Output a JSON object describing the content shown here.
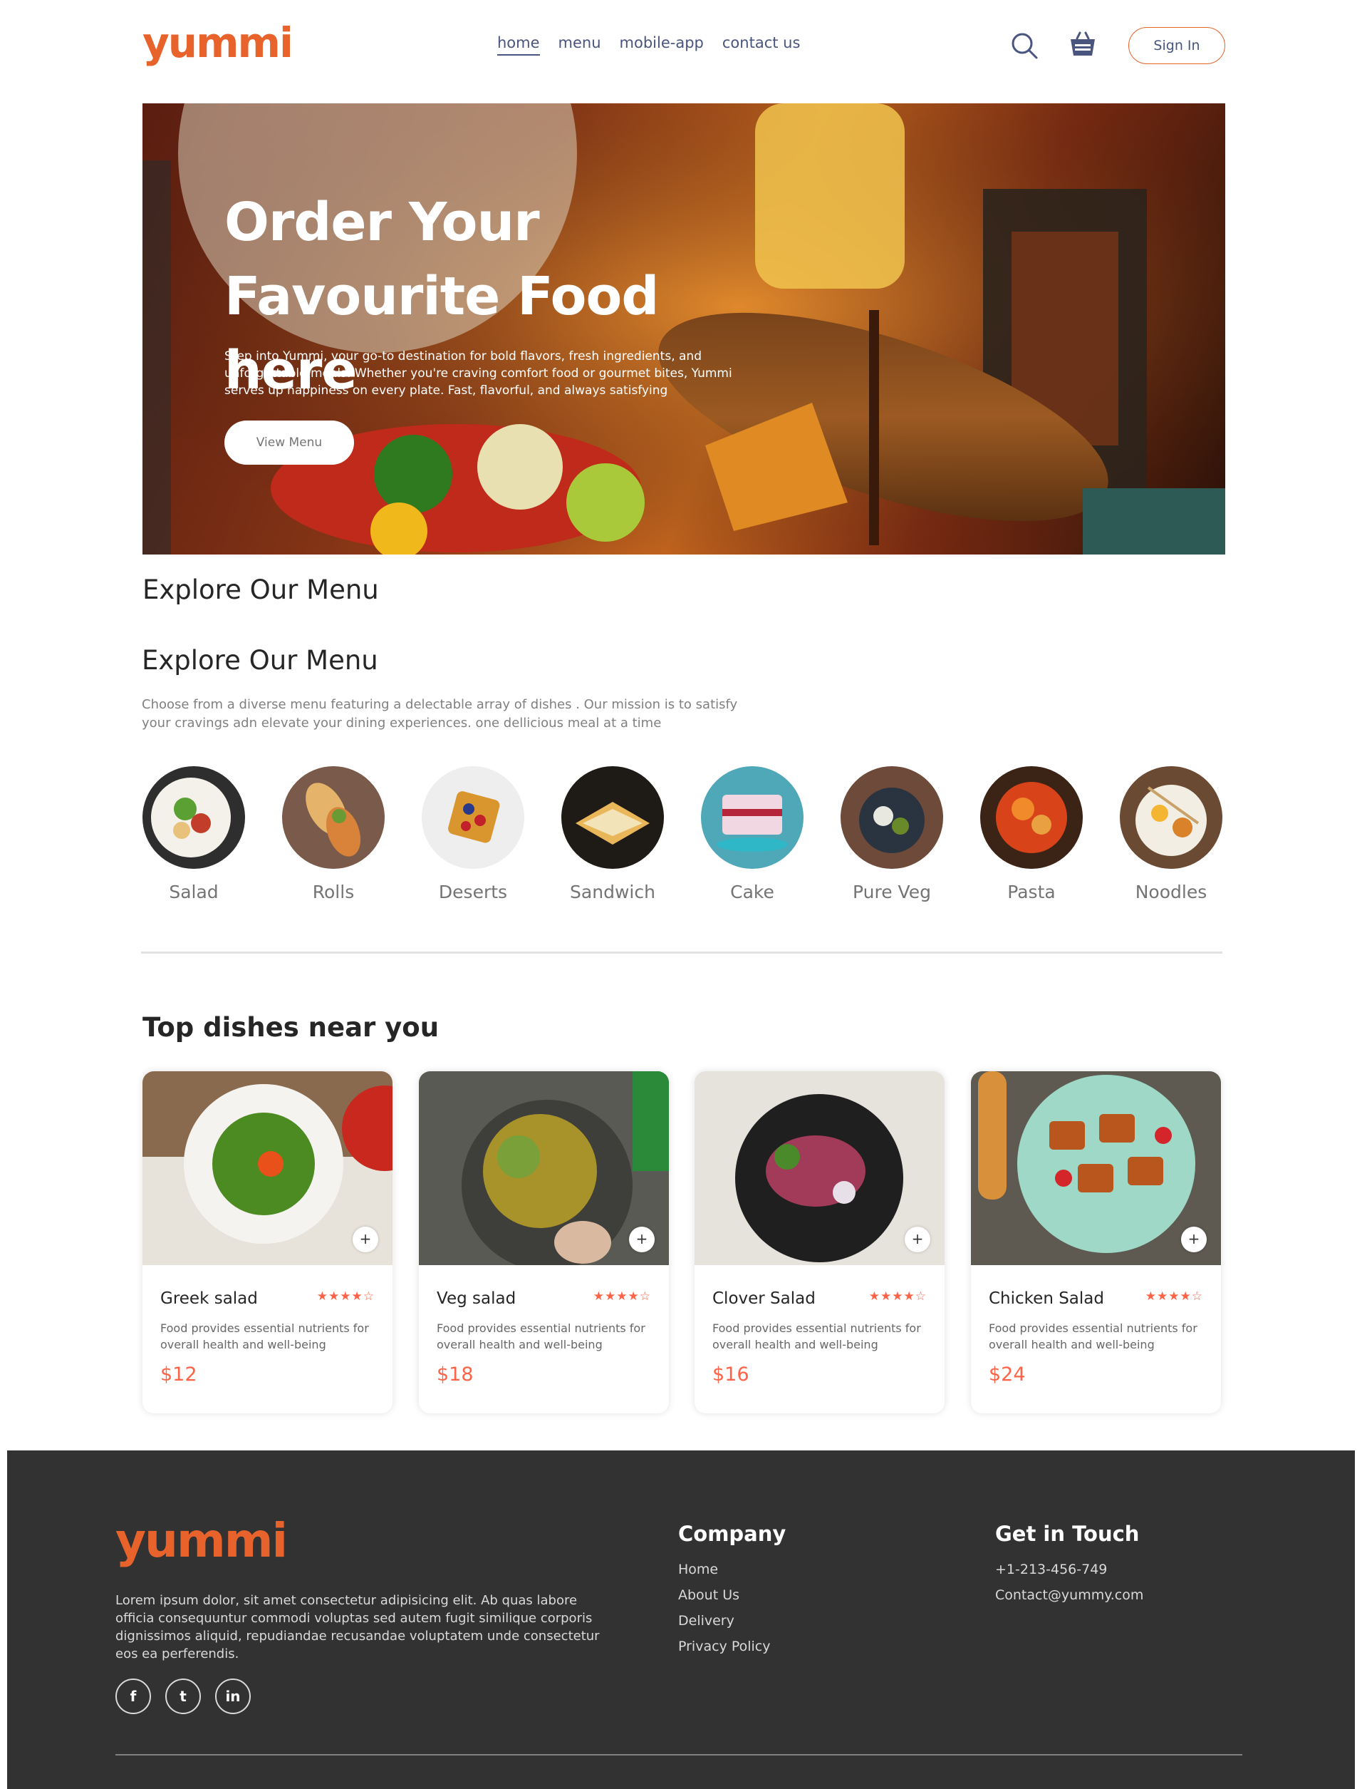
{
  "brand": {
    "name": "yummi",
    "accent": "#e8632c",
    "price_color": "#ff6347"
  },
  "navbar": {
    "links": [
      "home",
      "menu",
      "mobile-app",
      "contact us"
    ],
    "active": "home",
    "search_icon": "search-icon",
    "basket_icon": "basket-icon",
    "signin_label": "Sign In"
  },
  "hero": {
    "title": "Order Your Favourite Food here",
    "text": "Step into Yummi, your go-to destination for bold flavors, fresh ingredients, and unforgettable meals. Whether you're craving comfort food or gourmet bites, Yummi serves up happiness on every plate. Fast, flavorful, and always satisfying",
    "button_label": "View Menu"
  },
  "menu": {
    "heading_1": "Explore Our Menu",
    "heading_2": "Explore Our Menu",
    "description": "Choose from a diverse menu featuring a delectable array of dishes . Our mission is to satisfy your cravings adn elevate your dining experiences. one dellicious meal at a time",
    "items": [
      "Salad",
      "Rolls",
      "Deserts",
      "Sandwich",
      "Cake",
      "Pure Veg",
      "Pasta",
      "Noodles"
    ]
  },
  "dishes": {
    "title": "Top dishes near you",
    "items": [
      {
        "name": "Greek salad",
        "rating": "★★★★☆",
        "description": "Food provides essential nutrients for overall health and well-being",
        "price": "$12"
      },
      {
        "name": "Veg salad",
        "rating": "★★★★☆",
        "description": "Food provides essential nutrients for overall health and well-being",
        "price": "$18"
      },
      {
        "name": "Clover Salad",
        "rating": "★★★★☆",
        "description": "Food provides essential nutrients for overall health and well-being",
        "price": "$16"
      },
      {
        "name": "Chicken Salad",
        "rating": "★★★★☆",
        "description": "Food provides essential nutrients for overall health and well-being",
        "price": "$24"
      }
    ],
    "add_symbol": "+"
  },
  "footer": {
    "logo": "yummi",
    "text": "Lorem ipsum dolor, sit amet consectetur adipisicing elit. Ab quas labore officia consequuntur commodi voluptas sed autem fugit similique corporis dignissimos aliquid, repudiandae recusandae voluptatem unde consectetur eos ea perferendis.",
    "socials": [
      "f",
      "t",
      "in"
    ],
    "company": {
      "title": "Company",
      "links": [
        "Home",
        "About Us",
        "Delivery",
        "Privacy Policy"
      ]
    },
    "contact": {
      "title": "Get in Touch",
      "items": [
        "+1-213-456-749",
        "Contact@yummy.com"
      ]
    }
  }
}
